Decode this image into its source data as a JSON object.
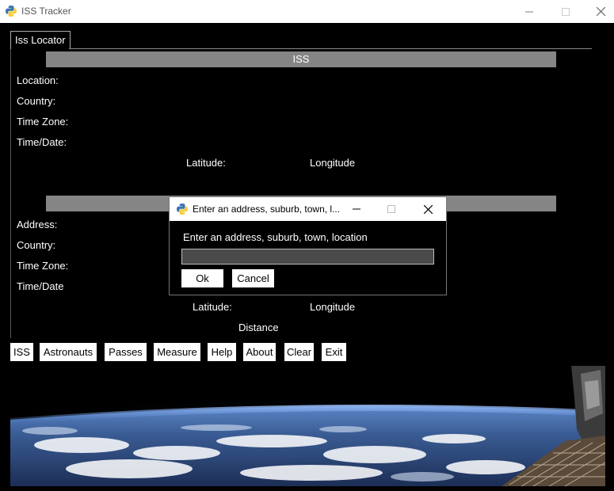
{
  "window": {
    "title": "ISS Tracker",
    "minimize_glyph": "—",
    "maximize_glyph": "☐",
    "close_glyph": "✕"
  },
  "tab": {
    "label": "Iss Locator"
  },
  "iss_section": {
    "header": "ISS",
    "location_label": "Location:",
    "country_label": "Country:",
    "timezone_label": "Time Zone:",
    "timedate_label": "Time/Date:",
    "latitude_label": "Latitude:",
    "longitude_label": "Longitude"
  },
  "address_section": {
    "header": "",
    "address_label": "Address:",
    "country_label": "Country:",
    "timezone_label": "Time Zone:",
    "timedate_label": "Time/Date",
    "latitude_label": "Latitude:",
    "longitude_label": "Longitude",
    "distance_label": "Distance"
  },
  "buttons": [
    "ISS",
    "Astronauts",
    "Passes",
    "Measure",
    "Help",
    "About",
    "Clear",
    "Exit"
  ],
  "dialog": {
    "title": "Enter an address, suburb, town, l...",
    "prompt": "Enter an address, suburb, town, location",
    "input_value": "",
    "ok_label": "Ok",
    "cancel_label": "Cancel",
    "minimize_glyph": "—",
    "maximize_glyph": "☐",
    "close_glyph": "✕"
  },
  "colors": {
    "background": "#000000",
    "header_bar": "#858585",
    "input_bg": "#4a4a4a"
  }
}
